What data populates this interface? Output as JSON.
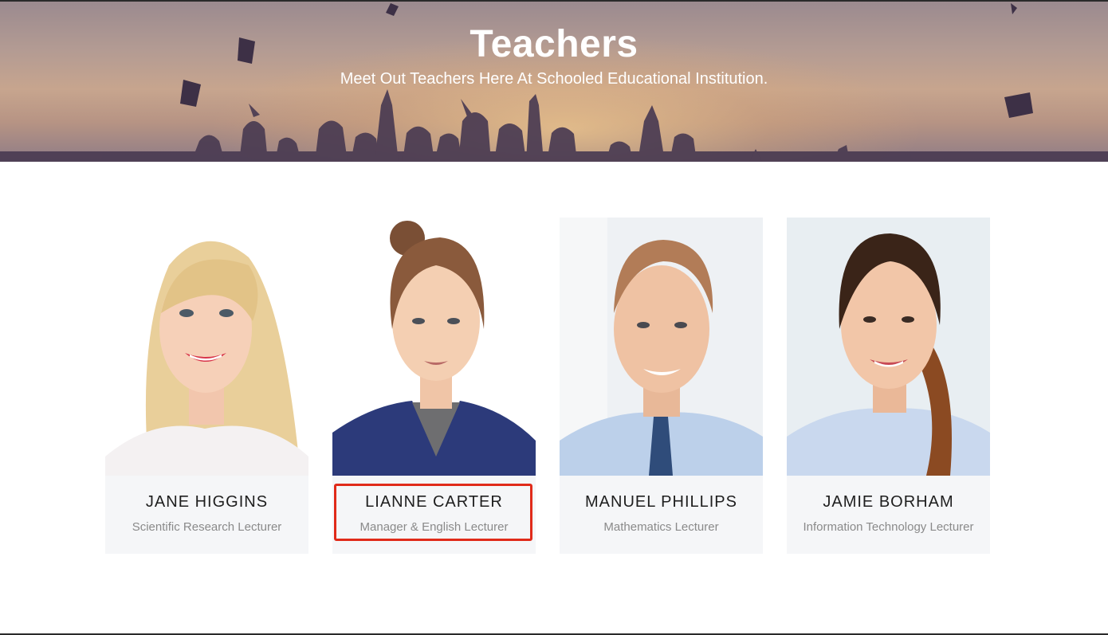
{
  "hero": {
    "title": "Teachers",
    "subtitle": "Meet Out Teachers Here At Schooled Educational Institution."
  },
  "teachers": [
    {
      "name": "JANE HIGGINS",
      "role": "Scientific Research Lecturer",
      "hair": "#e9cf9a",
      "bg": "#ffffff",
      "shirt": "#f4f1f2"
    },
    {
      "name": "LIANNE CARTER",
      "role": "Manager & English Lecturer",
      "hair": "#8a5a3c",
      "bg": "#ffffff",
      "shirt": "#2c3a7a",
      "highlighted": true
    },
    {
      "name": "MANUEL PHILLIPS",
      "role": "Mathematics Lecturer",
      "hair": "#b27c57",
      "bg": "#eef1f4",
      "shirt": "#bcd0ea"
    },
    {
      "name": "JAMIE BORHAM",
      "role": "Information Technology Lecturer",
      "hair": "#3a2418",
      "bg": "#e8eef2",
      "shirt": "#c9d8ee"
    }
  ],
  "colors": {
    "highlight_border": "#e02b1a",
    "info_background": "#f5f6f8",
    "name_text": "#1e1e1e",
    "role_text": "#8a8a8a"
  }
}
